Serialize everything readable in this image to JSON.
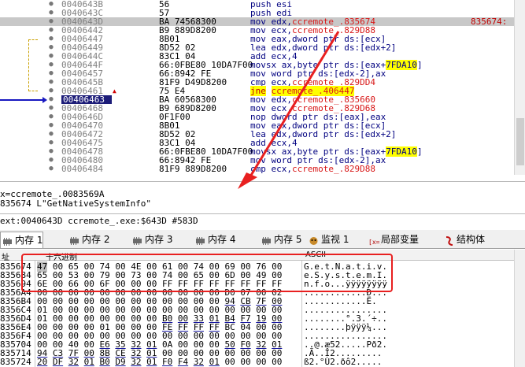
{
  "disasm_rows": [
    {
      "addr": "0040643B",
      "bytes": "56",
      "asm": "push esi"
    },
    {
      "addr": "0040643C",
      "bytes": "57",
      "asm": "push edi"
    },
    {
      "addr": "0040643D",
      "bytes": "BA 74568300",
      "asm_a": "mov edx,",
      "asm_b": "ccremote_.835674",
      "cmt": "835674:"
    },
    {
      "addr": "00406442",
      "bytes": "B9 889D8200",
      "asm_a": "mov ecx,",
      "asm_b": "ccremote_.829D88"
    },
    {
      "addr": "00406447",
      "bytes": "8B01",
      "asm": "mov eax,dword ptr ds:[ecx]"
    },
    {
      "addr": "00406449",
      "bytes": "8D52 02",
      "asm": "lea edx,dword ptr ds:[edx+2]"
    },
    {
      "addr": "0040644C",
      "bytes": "83C1 04",
      "asm": "add ecx,4"
    },
    {
      "addr": "0040644F",
      "bytes": "66:0FBE80 10DA7F00",
      "asm_a": "movsx ax,byte ptr ds:[eax+",
      "asm_b": "7FDA10",
      "asm_c": "]"
    },
    {
      "addr": "00406457",
      "bytes": "66:8942 FE",
      "asm": "mov word ptr ds:[edx-2],ax"
    },
    {
      "addr": "0040645B",
      "bytes": "81F9 D49D8200",
      "asm_a": "cmp ecx,",
      "asm_b": "ccremote_.829DD4"
    },
    {
      "addr": "00406461",
      "bytes": "75 E4",
      "asm_a": "jne",
      "asm_b": "ccremote_.406447"
    },
    {
      "addr": "00406463",
      "bytes": "BA 60568300",
      "asm_a": "mov edx,",
      "asm_b": "ccremote_.835660"
    },
    {
      "addr": "00406468",
      "bytes": "B9 689D8200",
      "asm_a": "mov ecx,",
      "asm_b": "ccremote_.829D68"
    },
    {
      "addr": "0040646D",
      "bytes": "0F1F00",
      "asm": "nop dword ptr ds:[eax],eax"
    },
    {
      "addr": "00406470",
      "bytes": "8B01",
      "asm": "mov eax,dword ptr ds:[ecx]"
    },
    {
      "addr": "00406472",
      "bytes": "8D52 02",
      "asm": "lea edx,dword ptr ds:[edx+2]"
    },
    {
      "addr": "00406475",
      "bytes": "83C1 04",
      "asm": "add ecx,4"
    },
    {
      "addr": "00406478",
      "bytes": "66:0FBE80 10DA7F00",
      "asm_a": "movsx ax,byte ptr ds:[eax+",
      "asm_b": "7FDA10",
      "asm_c": "]"
    },
    {
      "addr": "00406480",
      "bytes": "66:8942 FE",
      "asm": "mov word ptr ds:[edx-2],ax"
    },
    {
      "addr": "00406484",
      "bytes": "81F9 889D8200",
      "asm_a": "cmp ecx,",
      "asm_b": "ccremote_.829D88"
    }
  ],
  "info": {
    "line1": "x=ccremote_.0083569A",
    "line2": "835674 L\"GetNativeSystemInfo\"",
    "status": "ext:0040643D ccremote_.exe:$643D #583D"
  },
  "tabs": [
    {
      "label": "内存 1",
      "icon": "memory-icon"
    },
    {
      "label": "内存 2",
      "icon": "memory-icon"
    },
    {
      "label": "内存 3",
      "icon": "memory-icon"
    },
    {
      "label": "内存 4",
      "icon": "memory-icon"
    },
    {
      "label": "内存 5",
      "icon": "memory-icon"
    },
    {
      "label": "监视 1",
      "icon": "watch-icon"
    },
    {
      "label": "局部变量",
      "icon": "locals-icon",
      "prefix": "[x=]"
    },
    {
      "label": "结构体",
      "icon": "struct-icon"
    }
  ],
  "hex_header": {
    "addr": "址",
    "hex": "十六进制",
    "ascii": "ASCII"
  },
  "hex_rows": [
    {
      "addr": "835674",
      "b": [
        "47",
        "00",
        "65",
        "00",
        "74",
        "00",
        "4E",
        "00",
        "61",
        "00",
        "74",
        "00",
        "69",
        "00",
        "76",
        "00"
      ],
      "ascii": "G.e.t.N.a.t.i.v."
    },
    {
      "addr": "835684",
      "b": [
        "65",
        "00",
        "53",
        "00",
        "79",
        "00",
        "73",
        "00",
        "74",
        "00",
        "65",
        "00",
        "6D",
        "00",
        "49",
        "00"
      ],
      "ascii": "e.S.y.s.t.e.m.I."
    },
    {
      "addr": "835694",
      "b": [
        "6E",
        "00",
        "66",
        "00",
        "6F",
        "00",
        "00",
        "00",
        "FF",
        "FF",
        "FF",
        "FF",
        "FF",
        "FF",
        "FF",
        "FF"
      ],
      "ascii": "n.f.o...ÿÿÿÿÿÿÿÿ"
    },
    {
      "addr": "8356A4",
      "b": [
        "00",
        "00",
        "00",
        "00",
        "00",
        "00",
        "00",
        "00",
        "00",
        "00",
        "00",
        "00",
        "D0",
        "07",
        "00",
        "02"
      ],
      "ascii": "............Ð..."
    },
    {
      "addr": "8356B4",
      "b": [
        "00",
        "00",
        "00",
        "00",
        "00",
        "00",
        "00",
        "00",
        "00",
        "00",
        "00",
        "00",
        "94",
        "CB",
        "7F",
        "00"
      ],
      "ascii": "............Ë."
    },
    {
      "addr": "8356C4",
      "b": [
        "01",
        "00",
        "00",
        "00",
        "00",
        "00",
        "00",
        "00",
        "00",
        "00",
        "00",
        "00",
        "00",
        "00",
        "00",
        "00"
      ],
      "ascii": "................"
    },
    {
      "addr": "8356D4",
      "b": [
        "01",
        "00",
        "00",
        "00",
        "00",
        "00",
        "00",
        "00",
        "B0",
        "00",
        "33",
        "01",
        "B4",
        "F7",
        "19",
        "00"
      ],
      "ascii": "........°.3.´÷.."
    },
    {
      "addr": "8356E4",
      "b": [
        "00",
        "00",
        "00",
        "00",
        "01",
        "00",
        "00",
        "00",
        "FE",
        "FF",
        "FF",
        "FF",
        "BC",
        "04",
        "00",
        "00"
      ],
      "ascii": "........þÿÿÿ¼..."
    },
    {
      "addr": "8356F4",
      "b": [
        "00",
        "00",
        "00",
        "00",
        "00",
        "00",
        "00",
        "00",
        "00",
        "00",
        "00",
        "00",
        "00",
        "00",
        "00",
        "00"
      ],
      "ascii": "................"
    },
    {
      "addr": "835704",
      "b": [
        "00",
        "00",
        "40",
        "00",
        "E6",
        "35",
        "32",
        "01",
        "0A",
        "00",
        "00",
        "00",
        "50",
        "F0",
        "32",
        "01"
      ],
      "ascii": "..@.æ52.....Pð2."
    },
    {
      "addr": "835714",
      "b": [
        "94",
        "C3",
        "7F",
        "00",
        "8B",
        "CE",
        "32",
        "01",
        "00",
        "00",
        "00",
        "00",
        "00",
        "00",
        "00",
        "00"
      ],
      "ascii": ".Ã..Î2........."
    },
    {
      "addr": "835724",
      "b": [
        "20",
        "DF",
        "32",
        "01",
        "B0",
        "D9",
        "32",
        "01",
        "F0",
        "F4",
        "32",
        "01",
        "00",
        "00",
        "00",
        "00"
      ],
      "ascii": " ß2.°Ù2.ðô2....."
    }
  ]
}
